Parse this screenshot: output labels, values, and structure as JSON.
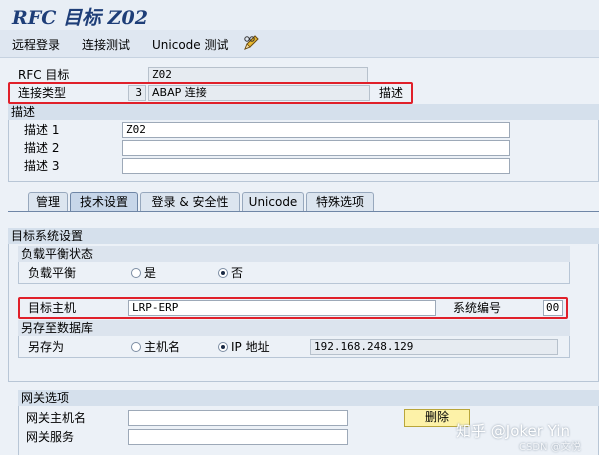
{
  "title": "RFC 目标 Z02",
  "toolbar": {
    "remote_login": "远程登录",
    "connection_test": "连接测试",
    "unicode_test": "Unicode 测试"
  },
  "header": {
    "rfc_target_label": "RFC 目标",
    "rfc_target_value": "Z02",
    "conn_type_label": "连接类型",
    "conn_type_code": "3",
    "conn_type_value": "ABAP 连接",
    "desc_link": "描述"
  },
  "description": {
    "group_title": "描述",
    "rows": [
      {
        "label": "描述 1",
        "value": "Z02"
      },
      {
        "label": "描述 2",
        "value": ""
      },
      {
        "label": "描述 3",
        "value": ""
      }
    ]
  },
  "tabs": [
    "管理",
    "技术设置",
    "登录 & 安全性",
    "Unicode",
    "特殊选项"
  ],
  "target_system": {
    "group_title": "目标系统设置",
    "load_balance_title": "负载平衡状态",
    "load_balance_label": "负载平衡",
    "option_yes": "是",
    "option_no": "否",
    "selected": "否",
    "target_host_label": "目标主机",
    "target_host_value": "LRP-ERP",
    "sys_no_label": "系统编号",
    "sys_no_value": "00",
    "save_to_db_title": "另存至数据库",
    "save_as_label": "另存为",
    "option_hostname": "主机名",
    "option_ip": "IP 地址",
    "save_as_selected": "IP 地址",
    "ip_value": "192.168.248.129"
  },
  "gateway": {
    "group_title": "网关选项",
    "host_label": "网关主机名",
    "host_value": "",
    "service_label": "网关服务",
    "service_value": "",
    "delete_button": "删除"
  },
  "watermark": {
    "zhihu": "知乎 @Joker Yin",
    "csdn": "CSDN @文悦"
  },
  "colors": {
    "background": "#ECF1F7",
    "title_text": "#1E3E78",
    "highlight_red": "#E0202A",
    "button_yellow": "#FDF2A8"
  }
}
